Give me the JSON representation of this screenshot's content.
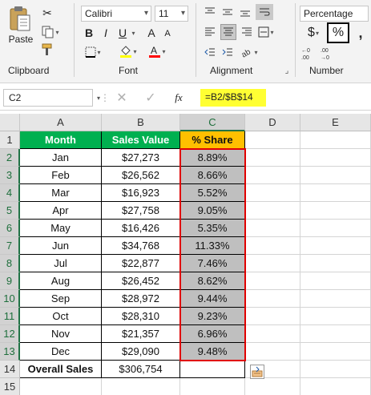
{
  "ribbon": {
    "clipboard": {
      "paste_label": "Paste",
      "group_label": "Clipboard"
    },
    "font": {
      "font_name": "Calibri",
      "font_size": "11",
      "bold": "B",
      "italic": "I",
      "underline": "U",
      "grow": "A",
      "shrink": "A",
      "group_label": "Font"
    },
    "alignment": {
      "group_label": "Alignment"
    },
    "number": {
      "format": "Percentage",
      "currency": "$",
      "percent": "%",
      "comma": ",",
      "group_label": "Number"
    }
  },
  "formula_bar": {
    "name_box": "C2",
    "fx": "fx",
    "formula": "=B2/$B$14"
  },
  "grid": {
    "columns": [
      "A",
      "B",
      "C",
      "D",
      "E"
    ],
    "rows": [
      "1",
      "2",
      "3",
      "4",
      "5",
      "6",
      "7",
      "8",
      "9",
      "10",
      "11",
      "12",
      "13",
      "14",
      "15"
    ],
    "headers": {
      "month": "Month",
      "sales": "Sales Value",
      "share": "% Share"
    },
    "data": [
      {
        "month": "Jan",
        "sales": "$27,273",
        "share": "8.89%"
      },
      {
        "month": "Feb",
        "sales": "$26,562",
        "share": "8.66%"
      },
      {
        "month": "Mar",
        "sales": "$16,923",
        "share": "5.52%"
      },
      {
        "month": "Apr",
        "sales": "$27,758",
        "share": "9.05%"
      },
      {
        "month": "May",
        "sales": "$16,426",
        "share": "5.35%"
      },
      {
        "month": "Jun",
        "sales": "$34,768",
        "share": "11.33%"
      },
      {
        "month": "Jul",
        "sales": "$22,877",
        "share": "7.46%"
      },
      {
        "month": "Aug",
        "sales": "$26,452",
        "share": "8.62%"
      },
      {
        "month": "Sep",
        "sales": "$28,972",
        "share": "9.44%"
      },
      {
        "month": "Oct",
        "sales": "$28,310",
        "share": "9.23%"
      },
      {
        "month": "Nov",
        "sales": "$21,357",
        "share": "6.96%"
      },
      {
        "month": "Dec",
        "sales": "$29,090",
        "share": "9.48%"
      }
    ],
    "total": {
      "label": "Overall Sales",
      "value": "$306,754"
    }
  },
  "colors": {
    "header_green": "#00b050",
    "header_orange": "#ffc000",
    "selection_red": "#e00000",
    "formula_highlight": "#ffff33",
    "excel_green": "#217346"
  }
}
